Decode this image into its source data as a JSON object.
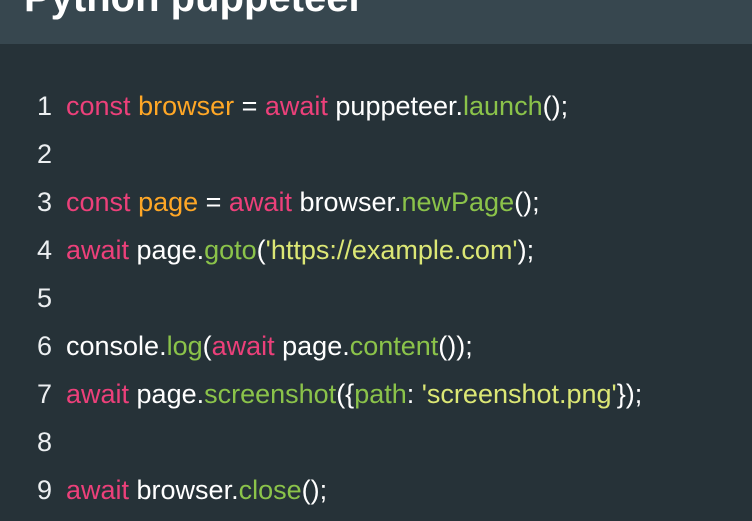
{
  "colors": {
    "background": "#263238",
    "header_background": "#37474f",
    "keyword": "#ec407a",
    "variable": "#ffa726",
    "method": "#8bc34a",
    "string": "#dce775",
    "plain": "#ffffff",
    "line_number": "#eceff1"
  },
  "header": {
    "title": "Python puppeteer"
  },
  "code_lines": [
    {
      "number": "1",
      "tokens": [
        {
          "text": "const",
          "type": "keyword"
        },
        {
          "text": " ",
          "type": "plain"
        },
        {
          "text": "browser",
          "type": "variable"
        },
        {
          "text": " = ",
          "type": "plain"
        },
        {
          "text": "await",
          "type": "keyword"
        },
        {
          "text": " puppeteer.",
          "type": "plain"
        },
        {
          "text": "launch",
          "type": "method"
        },
        {
          "text": "();",
          "type": "plain"
        }
      ]
    },
    {
      "number": "2",
      "tokens": []
    },
    {
      "number": "3",
      "tokens": [
        {
          "text": "const",
          "type": "keyword"
        },
        {
          "text": " ",
          "type": "plain"
        },
        {
          "text": "page",
          "type": "variable"
        },
        {
          "text": " = ",
          "type": "plain"
        },
        {
          "text": "await",
          "type": "keyword"
        },
        {
          "text": " browser.",
          "type": "plain"
        },
        {
          "text": "newPage",
          "type": "method"
        },
        {
          "text": "();",
          "type": "plain"
        }
      ]
    },
    {
      "number": "4",
      "tokens": [
        {
          "text": "await",
          "type": "keyword"
        },
        {
          "text": " page.",
          "type": "plain"
        },
        {
          "text": "goto",
          "type": "method"
        },
        {
          "text": "(",
          "type": "plain"
        },
        {
          "text": "'https://example.com'",
          "type": "string"
        },
        {
          "text": ");",
          "type": "plain"
        }
      ]
    },
    {
      "number": "5",
      "tokens": []
    },
    {
      "number": "6",
      "tokens": [
        {
          "text": "console.",
          "type": "plain"
        },
        {
          "text": "log",
          "type": "method"
        },
        {
          "text": "(",
          "type": "plain"
        },
        {
          "text": "await",
          "type": "keyword"
        },
        {
          "text": " page.",
          "type": "plain"
        },
        {
          "text": "content",
          "type": "method"
        },
        {
          "text": "());",
          "type": "plain"
        }
      ]
    },
    {
      "number": "7",
      "tokens": [
        {
          "text": "await",
          "type": "keyword"
        },
        {
          "text": " page.",
          "type": "plain"
        },
        {
          "text": "screenshot",
          "type": "method"
        },
        {
          "text": "({",
          "type": "plain"
        },
        {
          "text": "path",
          "type": "property"
        },
        {
          "text": ": ",
          "type": "plain"
        },
        {
          "text": "'screenshot.png'",
          "type": "string"
        },
        {
          "text": "});",
          "type": "plain"
        }
      ]
    },
    {
      "number": "8",
      "tokens": []
    },
    {
      "number": "9",
      "tokens": [
        {
          "text": "await",
          "type": "keyword"
        },
        {
          "text": " browser.",
          "type": "plain"
        },
        {
          "text": "close",
          "type": "method"
        },
        {
          "text": "();",
          "type": "plain"
        }
      ]
    }
  ]
}
